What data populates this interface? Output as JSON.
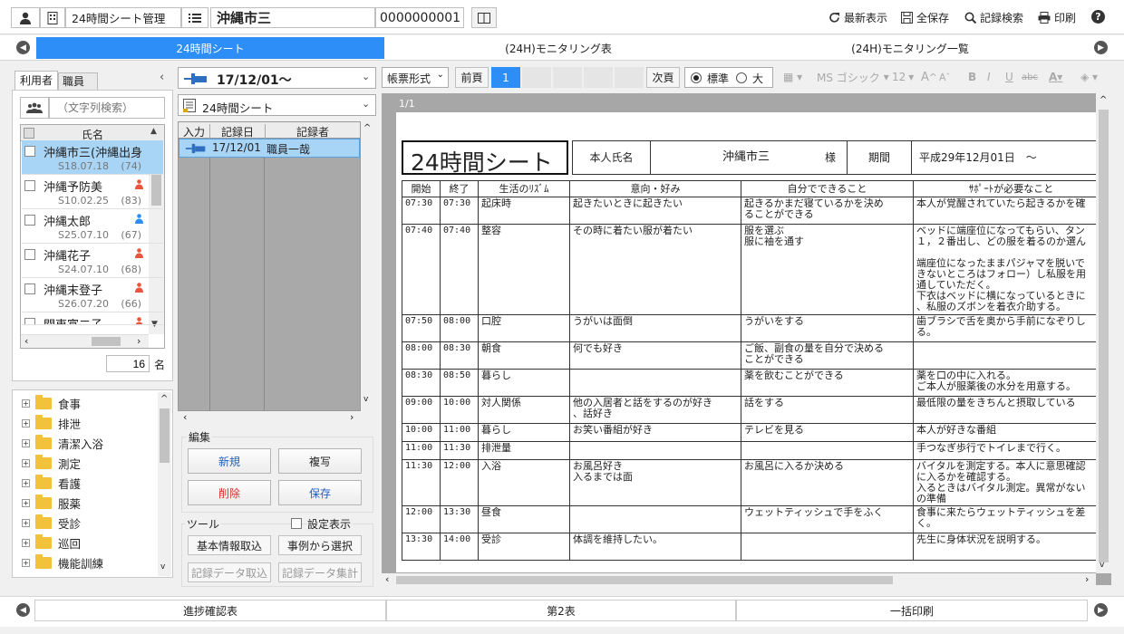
{
  "header": {
    "module_name": "24時間シート管理",
    "patient_name": "沖縄市三",
    "patient_id": "0000000001",
    "actions": [
      {
        "icon": "refresh-icon",
        "label": "最新表示"
      },
      {
        "icon": "save-icon",
        "label": "全保存"
      },
      {
        "icon": "search-icon",
        "label": "記録検索"
      },
      {
        "icon": "print-icon",
        "label": "印刷"
      }
    ]
  },
  "nav": {
    "tabs": [
      "24時間シート",
      "(24H)モニタリング表",
      "(24H)モニタリング一覧"
    ]
  },
  "left": {
    "tabs": [
      "利用者",
      "職員"
    ],
    "search_placeholder": "（文字列検索）",
    "list_header": "氏名",
    "persons": [
      {
        "name": "沖縄市三(沖縄出身",
        "date": "S18.07.18",
        "age": "(74)",
        "gender": "",
        "selected": true
      },
      {
        "name": "沖縄予防美",
        "date": "S10.02.25",
        "age": "(83)",
        "gender": "female"
      },
      {
        "name": "沖縄太郎",
        "date": "S25.07.10",
        "age": "(67)",
        "gender": "male"
      },
      {
        "name": "沖縄花子",
        "date": "S24.07.10",
        "age": "(68)",
        "gender": "female"
      },
      {
        "name": "沖縄末登子",
        "date": "S26.07.20",
        "age": "(66)",
        "gender": "female"
      },
      {
        "name": "関東富二子",
        "date": "",
        "age": "",
        "gender": "female"
      }
    ],
    "count": "16",
    "count_unit": "名",
    "tree": [
      "食事",
      "排泄",
      "清潔入浴",
      "測定",
      "看護",
      "服薬",
      "受診",
      "巡回",
      "機能訓練"
    ]
  },
  "middle": {
    "date_value": "17/12/01～",
    "sheet_type": "24時間シート",
    "columns": [
      "入力",
      "記録日",
      "記録者"
    ],
    "records": [
      {
        "date": "17/12/01",
        "recorder": "職員一哉"
      }
    ],
    "edit_label": "編集",
    "buttons": {
      "new": "新規",
      "copy": "複写",
      "delete": "削除",
      "save": "保存"
    },
    "tools_label": "ツール",
    "settings_label": "設定表示",
    "tool_buttons": [
      "基本情報取込",
      "事例から選択",
      "記録データ取込",
      "記録データ集計"
    ]
  },
  "toolbar": {
    "format_select": "帳票形式",
    "prev": "前頁",
    "page": "1",
    "next": "次頁",
    "size_standard": "標準",
    "size_large": "大",
    "font": "MS ゴシック",
    "font_size": "12",
    "fmt_buttons": [
      "A",
      "A",
      "B",
      "I",
      "U",
      "abc",
      "A"
    ]
  },
  "document": {
    "page_indicator": "1/1",
    "title": "24時間シート",
    "name_label": "本人氏名",
    "name_value": "沖縄市三",
    "honorific": "様",
    "period_label": "期間",
    "period_value": "平成29年12月01日　～",
    "columns": [
      "開始",
      "終了",
      "生活のﾘｽﾞﾑ",
      "意向・好み",
      "自分でできること",
      "ｻﾎﾟｰﾄが必要なこと"
    ],
    "rows": [
      {
        "start": "07:30",
        "end": "07:30",
        "rhythm": "起床時",
        "pref": "起きたいときに起きたい",
        "can": "起きるかまだ寝ているかを決め\nることができる",
        "support": "本人が覚醒されていたら起きるかを確"
      },
      {
        "start": "07:40",
        "end": "07:40",
        "rhythm": "整容",
        "pref": "その時に着たい服が着たい",
        "can": "服を選ぶ\n服に袖を通す",
        "support": "ベッドに端座位になってもらい、タン\n１，２番出し、どの服を着るのか選ん\n\n端座位になったままパジャマを脱いで\nきないところはフォロー）し私服を用\n通していただく。\n下衣はベッドに横になっているときに\n、私服のズボンを着衣介助する。"
      },
      {
        "start": "07:50",
        "end": "08:00",
        "rhythm": "口腔",
        "pref": "うがいは面倒",
        "can": "うがいをする",
        "support": "歯ブラシで舌を奥から手前になぞりし\nる。"
      },
      {
        "start": "08:00",
        "end": "08:30",
        "rhythm": "朝食",
        "pref": "何でも好き",
        "can": "ご飯、副食の量を自分で決める\nことができる",
        "support": ""
      },
      {
        "start": "08:30",
        "end": "08:50",
        "rhythm": "暮らし",
        "pref": "",
        "can": "薬を飲むことができる",
        "support": "薬を口の中に入れる。\nご本人が服薬後の水分を用意する。"
      },
      {
        "start": "09:00",
        "end": "10:00",
        "rhythm": "対人関係",
        "pref": "他の入居者と話をするのが好き\n、話好き",
        "can": "話をする",
        "support": "最低限の量をきちんと摂取している"
      },
      {
        "start": "10:00",
        "end": "11:00",
        "rhythm": "暮らし",
        "pref": "お笑い番組が好き",
        "can": "テレビを見る",
        "support": "本人が好きな番組"
      },
      {
        "start": "11:00",
        "end": "11:30",
        "rhythm": "排泄量",
        "pref": "",
        "can": "",
        "support": "手つなぎ歩行でトイレまで行く。"
      },
      {
        "start": "11:30",
        "end": "12:00",
        "rhythm": "入浴",
        "pref": "お風呂好き\n入るまでは面",
        "can": "お風呂に入るか決める",
        "support": "バイタルを測定する。本人に意思確認\nに入るかを確認する。\n入るときはバイタル測定。異常がない\nの準備"
      },
      {
        "start": "12:00",
        "end": "13:30",
        "rhythm": "昼食",
        "pref": "",
        "can": "ウェットティッシュで手をふく",
        "support": "食事に来たらウェットティッシュを差\nく。"
      },
      {
        "start": "13:30",
        "end": "14:00",
        "rhythm": "受診",
        "pref": "体調を維持したい。",
        "can": "",
        "support": "先生に身体状況を説明する。"
      }
    ]
  },
  "footer": {
    "tabs": [
      "進捗確認表",
      "第2表",
      "一括印刷"
    ]
  }
}
